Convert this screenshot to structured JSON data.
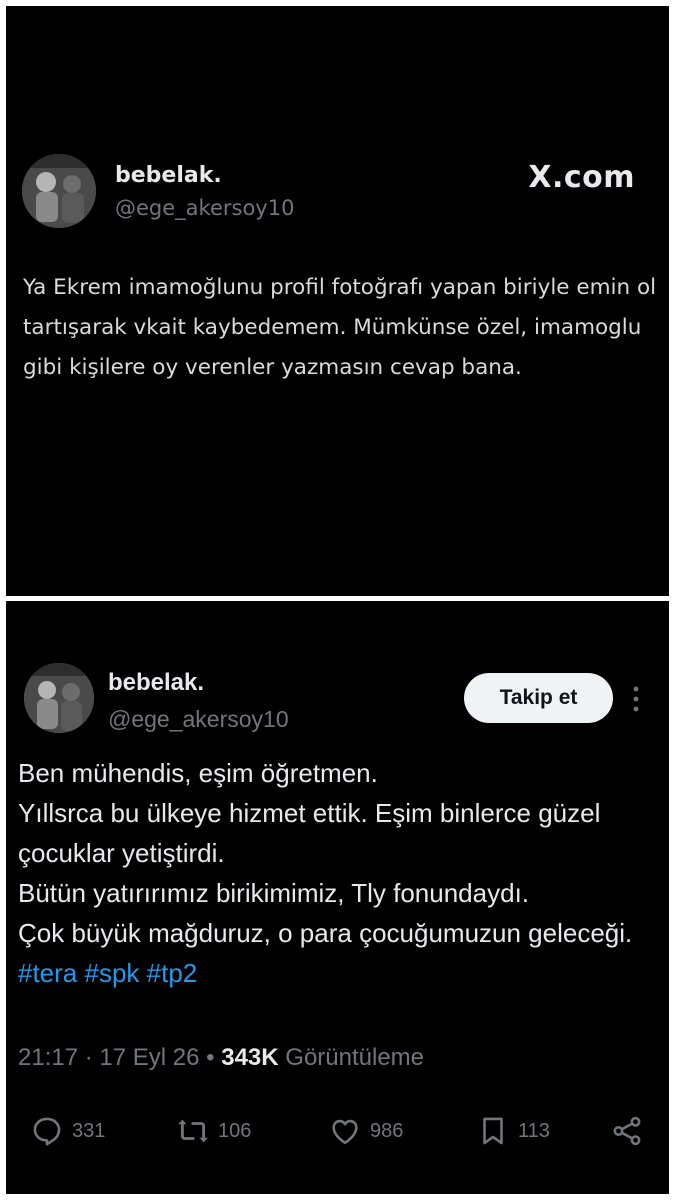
{
  "tweet1": {
    "display_name": "bebelak.",
    "handle": "@ege_akersoy10",
    "brand": "X.com",
    "text": "Ya Ekrem imamoğlunu profil fotoğrafı yapan biriyle emin ol tartışarak vkait kaybedemem. Mümkünse özel, imamoglu gibi kişilere oy verenler yazmasın cevap bana."
  },
  "tweet2": {
    "display_name": "bebelak.",
    "handle": "@ege_akersoy10",
    "follow_label": "Takip et",
    "text_body": "Ben mühendis, eşim öğretmen.\nYıllsrca bu ülkeye hizmet ettik. Eşim binlerce güzel çocuklar yetiştirdi.\nBütün yatırırımız birikimimiz, Tly fonundaydı.\nÇok büyük mağduruz, o para çocuğumuzun geleceği.",
    "hashtags": [
      "#tera",
      "#spk",
      "#tp2"
    ],
    "time": "21:17",
    "date": "17 Eyl 26",
    "views_count": "343K",
    "views_label": "Görüntüleme",
    "actions": {
      "replies": "331",
      "retweets": "106",
      "likes": "986",
      "bookmarks": "113"
    }
  },
  "icons": [
    "reply-icon",
    "retweet-icon",
    "like-icon",
    "bookmark-icon",
    "share-icon",
    "more-options-icon"
  ],
  "colors": {
    "background": "#000000",
    "text": "#e7e9ea",
    "muted": "#71767b",
    "link": "#1d9bf0",
    "button": "#eff3f4"
  }
}
